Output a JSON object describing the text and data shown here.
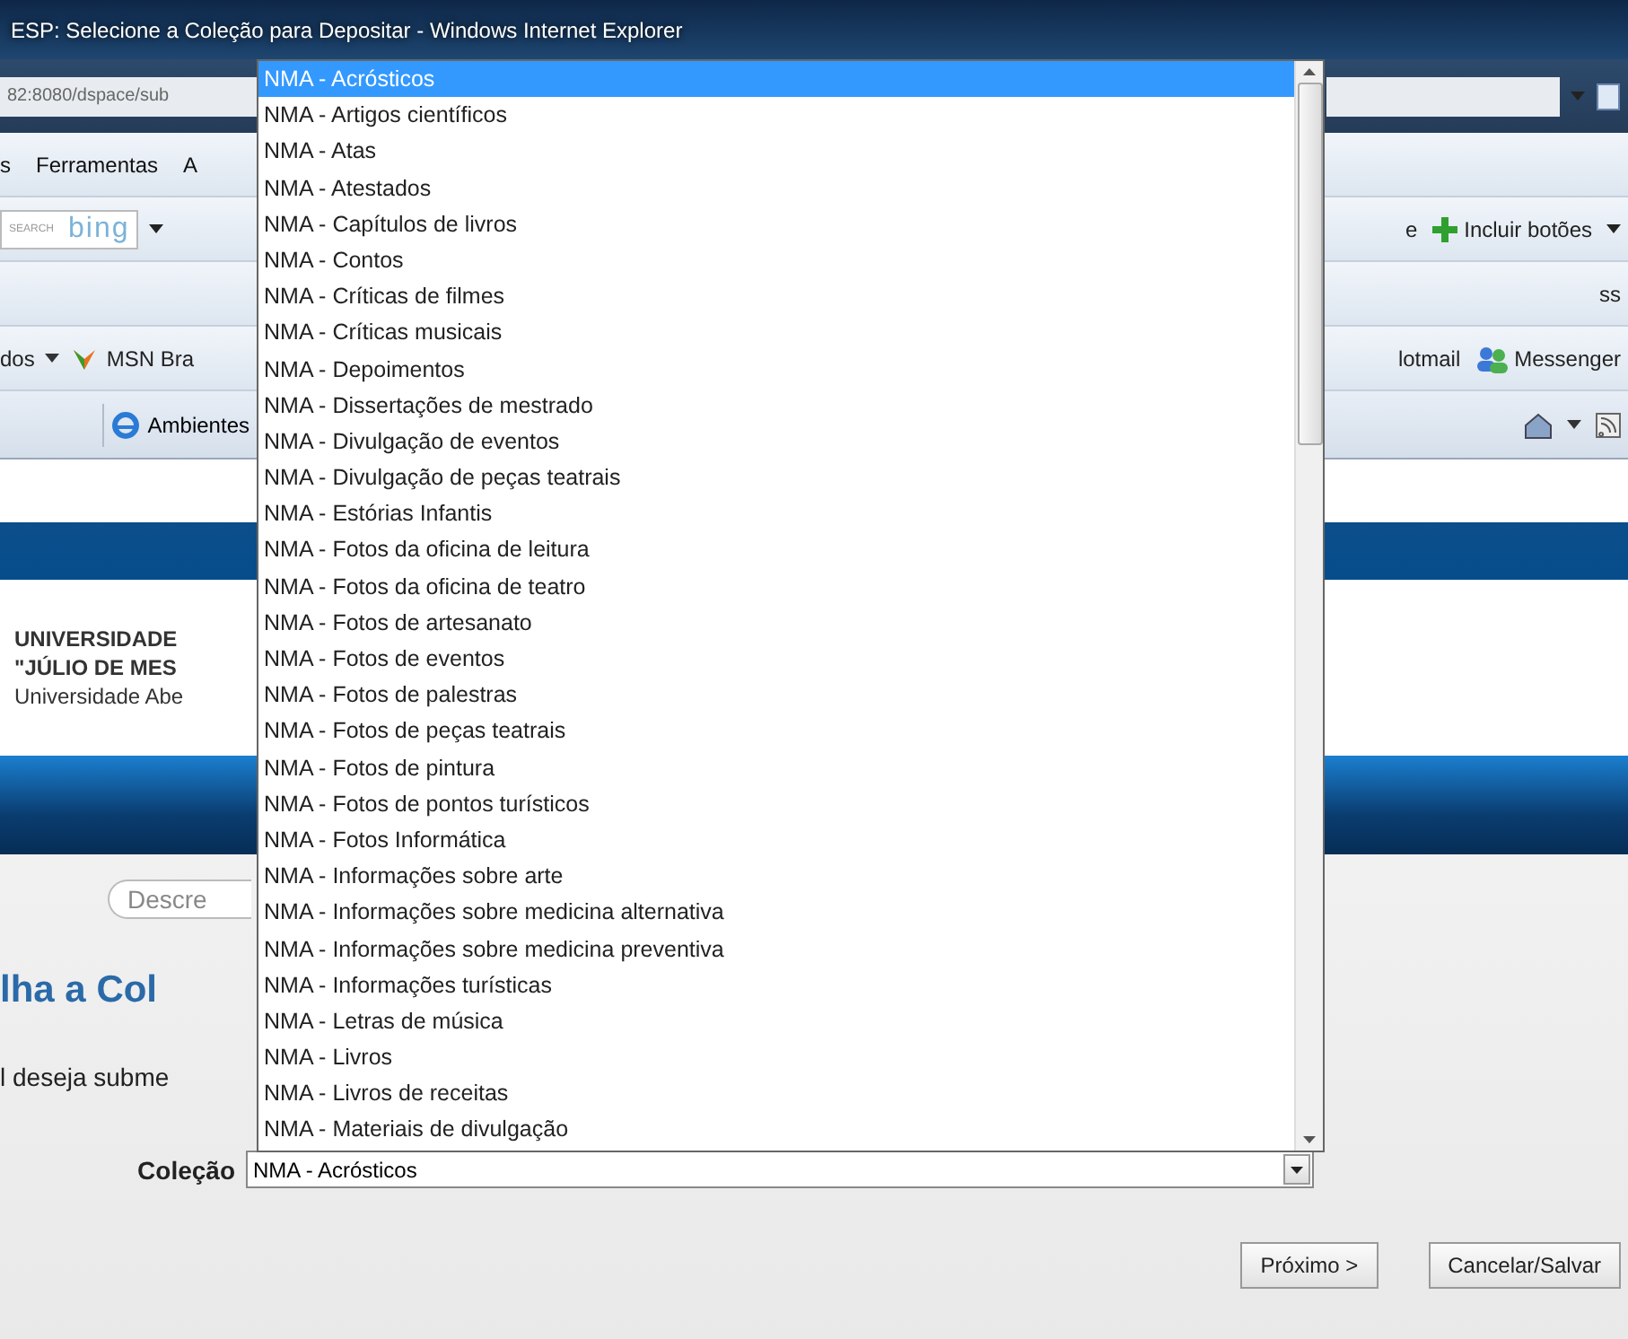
{
  "window": {
    "title": "ESP: Selecione a Coleção para Depositar - Windows Internet Explorer"
  },
  "address_bar": {
    "value": "82:8080/dspace/sub"
  },
  "menu_bar": {
    "items": [
      "s",
      "Ferramentas",
      "A"
    ]
  },
  "search_toolbar": {
    "label": "SEARCH",
    "logo": "bing"
  },
  "command_bar": {
    "items": [
      "e",
      "Incluir botões"
    ]
  },
  "links_bar": {
    "text": "ss"
  },
  "favorites_bar": {
    "items": [
      "dos",
      "MSN Bra",
      "lotmail",
      "Messenger"
    ]
  },
  "tab_bar": {
    "tab": "Ambientes"
  },
  "header": {
    "lines": [
      "UNIVERSIDADE",
      "\"JÚLIO DE MES",
      "Universidade Abe"
    ]
  },
  "search": {
    "placeholder": "Descre"
  },
  "page": {
    "heading": "lha a Col",
    "instruction": "l deseja subme"
  },
  "collection": {
    "label": "Coleção",
    "value": "NMA - Acrósticos",
    "expanded": true,
    "options": [
      {
        "label": "NMA - Acrósticos",
        "selected": true
      },
      {
        "label": "NMA - Artigos científicos",
        "selected": false
      },
      {
        "label": "NMA - Atas",
        "selected": false
      },
      {
        "label": "NMA - Atestados",
        "selected": false
      },
      {
        "label": "NMA - Capítulos de livros",
        "selected": false
      },
      {
        "label": "NMA - Contos",
        "selected": false
      },
      {
        "label": "NMA - Críticas de filmes",
        "selected": false
      },
      {
        "label": "NMA - Críticas musicais",
        "selected": false
      },
      {
        "label": "NMA - Depoimentos",
        "selected": false
      },
      {
        "label": "NMA - Dissertações de mestrado",
        "selected": false
      },
      {
        "label": "NMA - Divulgação de eventos",
        "selected": false
      },
      {
        "label": "NMA - Divulgação de peças teatrais",
        "selected": false
      },
      {
        "label": "NMA - Estórias Infantis",
        "selected": false
      },
      {
        "label": "NMA - Fotos da oficina de leitura",
        "selected": false
      },
      {
        "label": "NMA - Fotos da oficina de teatro",
        "selected": false
      },
      {
        "label": "NMA - Fotos de artesanato",
        "selected": false
      },
      {
        "label": "NMA - Fotos de eventos",
        "selected": false
      },
      {
        "label": "NMA - Fotos de palestras",
        "selected": false
      },
      {
        "label": "NMA - Fotos de peças teatrais",
        "selected": false
      },
      {
        "label": "NMA - Fotos de pintura",
        "selected": false
      },
      {
        "label": "NMA - Fotos de pontos turísticos",
        "selected": false
      },
      {
        "label": "NMA - Fotos Informática",
        "selected": false
      },
      {
        "label": "NMA - Informações sobre arte",
        "selected": false
      },
      {
        "label": "NMA - Informações sobre medicina alternativa",
        "selected": false
      },
      {
        "label": "NMA - Informações sobre medicina preventiva",
        "selected": false
      },
      {
        "label": "NMA - Informações turísticas",
        "selected": false
      },
      {
        "label": "NMA - Letras de música",
        "selected": false
      },
      {
        "label": "NMA - Livros",
        "selected": false
      },
      {
        "label": "NMA - Livros de receitas",
        "selected": false
      },
      {
        "label": "NMA - Materiais de divulgação",
        "selected": false
      }
    ]
  },
  "buttons": [
    "Próximo >",
    "Cancelar/Salvar"
  ]
}
